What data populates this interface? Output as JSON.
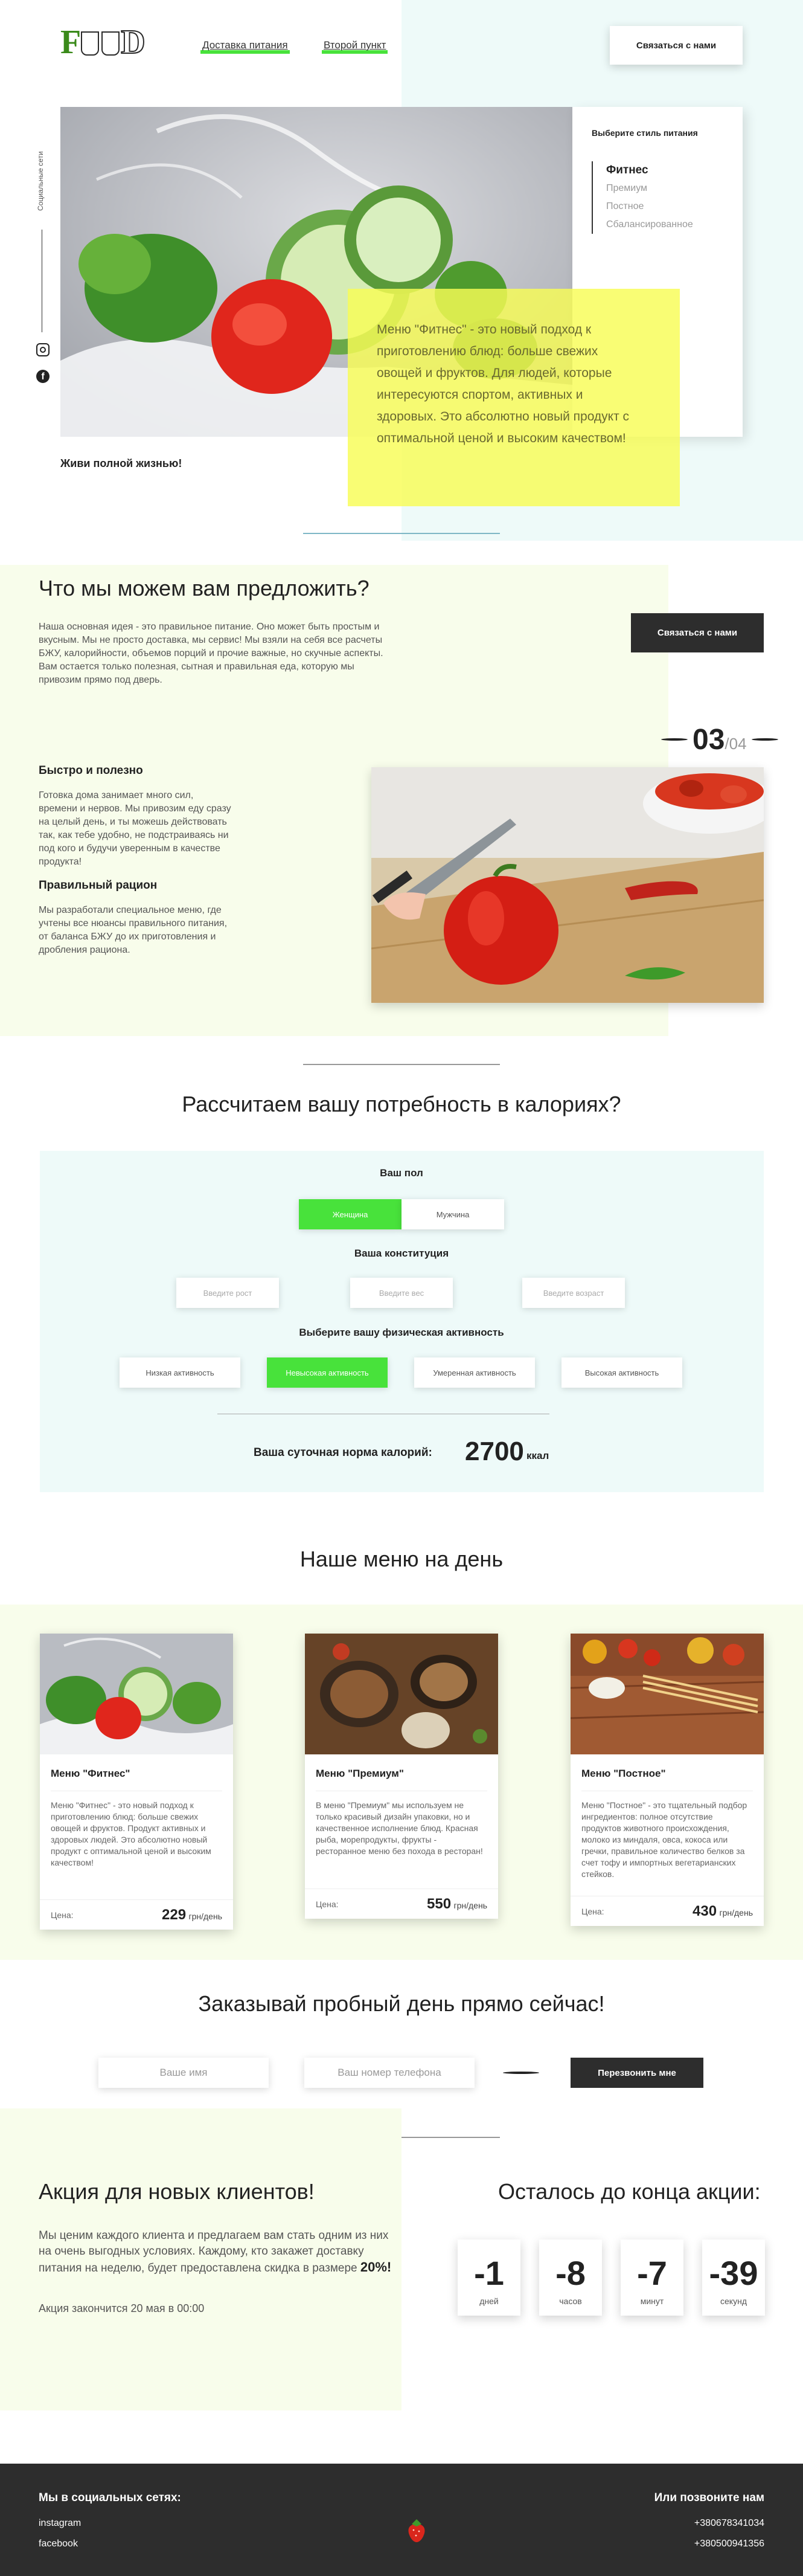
{
  "header": {
    "logo": "FOOD",
    "nav": [
      "Доставка питания",
      "Второй пункт"
    ],
    "contact_button": "Связаться с нами"
  },
  "hero": {
    "social_label": "Социальные сети",
    "panel_title": "Выберите стиль питания",
    "styles": [
      "Фитнес",
      "Премиум",
      "Постное",
      "Сбалансированное"
    ],
    "active_style": "Фитнес",
    "description": "Меню \"Фитнес\" - это новый подход к приготовлению блюд: больше свежих овощей и фруктов. Для людей, которые интересуются спортом, активных и здоровых. Это абсолютно новый продукт с оптимальной ценой и высоким качеством!",
    "motto": "Живи полной жизнью!"
  },
  "offer": {
    "title": "Что мы можем вам предложить?",
    "intro": "Наша основная идея - это правильное питание. Оно может быть простым и вкусным. Мы не просто доставка, мы сервис! Мы взяли на себя все расчеты БЖУ, калорийности, объемов порций и прочие важные, но скучные аспекты. Вам остается только полезная, сытная и правильная еда, которую мы привозим прямо под дверь.",
    "contact_button": "Связаться с нами",
    "counter_current": "03",
    "counter_total": "/04",
    "features": [
      {
        "title": "Быстро и полезно",
        "text": "Готовка дома занимает много сил, времени и нервов. Мы привозим еду сразу на целый день, и ты можешь действовать так, как тебе удобно, не подстраиваясь ни под кого и будучи уверенным в качестве продукта!"
      },
      {
        "title": "Правильный рацион",
        "text": "Мы разработали специальное меню, где учтены все нюансы правильного питания, от баланса БЖУ до их приготовления и дробления рациона."
      }
    ]
  },
  "calculator": {
    "title": "Рассчитаем вашу потребность в калориях?",
    "gender_label": "Ваш пол",
    "gender_options": [
      "Женщина",
      "Мужчина"
    ],
    "constitution_label": "Ваша конституция",
    "inputs": [
      "Введите рост",
      "Введите вес",
      "Введите возраст"
    ],
    "activity_label": "Выберите вашу физическая активность",
    "activity_options": [
      "Низкая активность",
      "Невысокая активность",
      "Умеренная активность",
      "Высокая активность"
    ],
    "result_label": "Ваша суточная норма калорий:",
    "result_value": "2700",
    "result_unit": "ккал"
  },
  "menu": {
    "title": "Наше меню на день",
    "price_label": "Цена:",
    "currency": "грн/день",
    "cards": [
      {
        "title": "Меню \"Фитнес\"",
        "text": "Меню \"Фитнес\" - это новый подход к приготовлению блюд: больше свежих овощей и фруктов. Продукт активных и здоровых людей. Это абсолютно новый продукт с оптимальной ценой и высоким качеством!",
        "price": "229"
      },
      {
        "title": "Меню \"Премиум\"",
        "text": "В меню \"Премиум\" мы используем не только красивый дизайн упаковки, но и качественное исполнение блюд. Красная рыба, морепродукты, фрукты - ресторанное меню без похода в ресторан!",
        "price": "550"
      },
      {
        "title": "Меню \"Постное\"",
        "text": "Меню \"Постное\" - это тщательный подбор ингредиентов: полное отсутствие продуктов животного происхождения, молоко из миндаля, овса, кокоса или гречки, правильное количество белков за счет тофу и импортных вегетарианских стейков.",
        "price": "430"
      }
    ]
  },
  "order": {
    "title": "Заказывай пробный день прямо сейчас!",
    "name_placeholder": "Ваше имя",
    "phone_placeholder": "Ваш номер телефона",
    "button": "Перезвонить мне"
  },
  "promo": {
    "title": "Акция для новых клиентов!",
    "text": "Мы ценим каждого клиента и предлагаем вам стать одним из них на очень выгодных условиях. Каждому, кто закажет доставку питания на неделю, будет предоставлена скидка в размере",
    "discount": "20%!",
    "ends": "Акция закончится 20 мая в 00:00",
    "timer_title": "Осталось до конца акции:",
    "timer": [
      {
        "value": "-1",
        "unit": "дней"
      },
      {
        "value": "-8",
        "unit": "часов"
      },
      {
        "value": "-7",
        "unit": "минут"
      },
      {
        "value": "-39",
        "unit": "секунд"
      }
    ]
  },
  "footer": {
    "social_title": "Мы в социальных сетях:",
    "links": [
      "instagram",
      "facebook"
    ],
    "phone_title": "Или позвоните нам",
    "phones": [
      "+380678341034",
      "+380500941356"
    ]
  },
  "colors": {
    "accent_green": "#48e23b",
    "dark": "#2d2d2d",
    "yellow": "#f8fc55",
    "light_blue": "#eefaf9",
    "light_yellow": "#f8fdeb"
  }
}
